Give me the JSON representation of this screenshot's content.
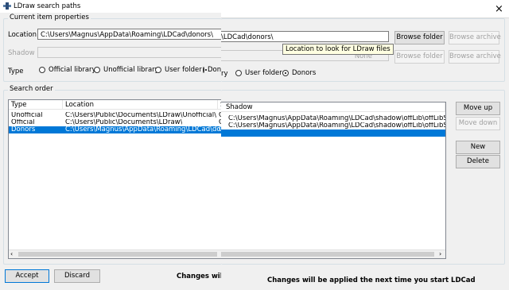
{
  "title": "LDraw search paths",
  "close_glyph": "×",
  "current_item": {
    "group_label": "Current item properties",
    "location_label": "Location",
    "location_value": "C:\\Users\\Magnus\\AppData\\Roaming\\LDCad\\donors\\",
    "location_value_partial": "\\LDCad\\donors\\",
    "shadow_label": "Shadow",
    "shadow_value": "None",
    "browse_folder": "Browse folder",
    "browse_archive": "Browse archive",
    "browse_folder_shadow": "Browse folder",
    "browse_archive_shadow": "Browse archive",
    "type_label": "Type",
    "types": [
      "Official library",
      "Unofficial library",
      "User folder",
      "Donors"
    ],
    "types_partial": [
      "ry",
      "User folder",
      "Donors"
    ],
    "selected_type": "Donors"
  },
  "tooltip": "Location to look for LDraw files",
  "search_order": {
    "group_label": "Search order",
    "columns": [
      "Type",
      "Location",
      "S"
    ],
    "rows": [
      {
        "type": "Unofficial",
        "location": "C:\\Users\\Public\\Documents\\LDraw\\Unofficial\\",
        "s": "C"
      },
      {
        "type": "Official",
        "location": "C:\\Users\\Public\\Documents\\LDraw\\",
        "s": "C"
      },
      {
        "type": "Donors",
        "location": "C:\\Users\\Magnus\\AppData\\Roaming\\LDCad\\donors\\",
        "s": "C"
      }
    ],
    "selected_row": 2,
    "shadow_column": "Shadow",
    "shadow_rows": [
      "C:\\Users\\Magnus\\AppData\\Roaming\\LDCad\\shadow\\offLib\\offLibShadow.csl",
      "C:\\Users\\Magnus\\AppData\\Roaming\\LDCad\\shadow\\offLib\\offLibShadow.csl",
      ""
    ],
    "move_up": "Move up",
    "move_down": "Move down",
    "new": "New",
    "delete": "Delete"
  },
  "footer": {
    "accept": "Accept",
    "discard": "Discard",
    "message_partial": "Changes wil",
    "message": "Changes will be applied the next time you start LDCad"
  },
  "colors": {
    "selection": "#0078d7",
    "window": "#f0f0f0"
  }
}
